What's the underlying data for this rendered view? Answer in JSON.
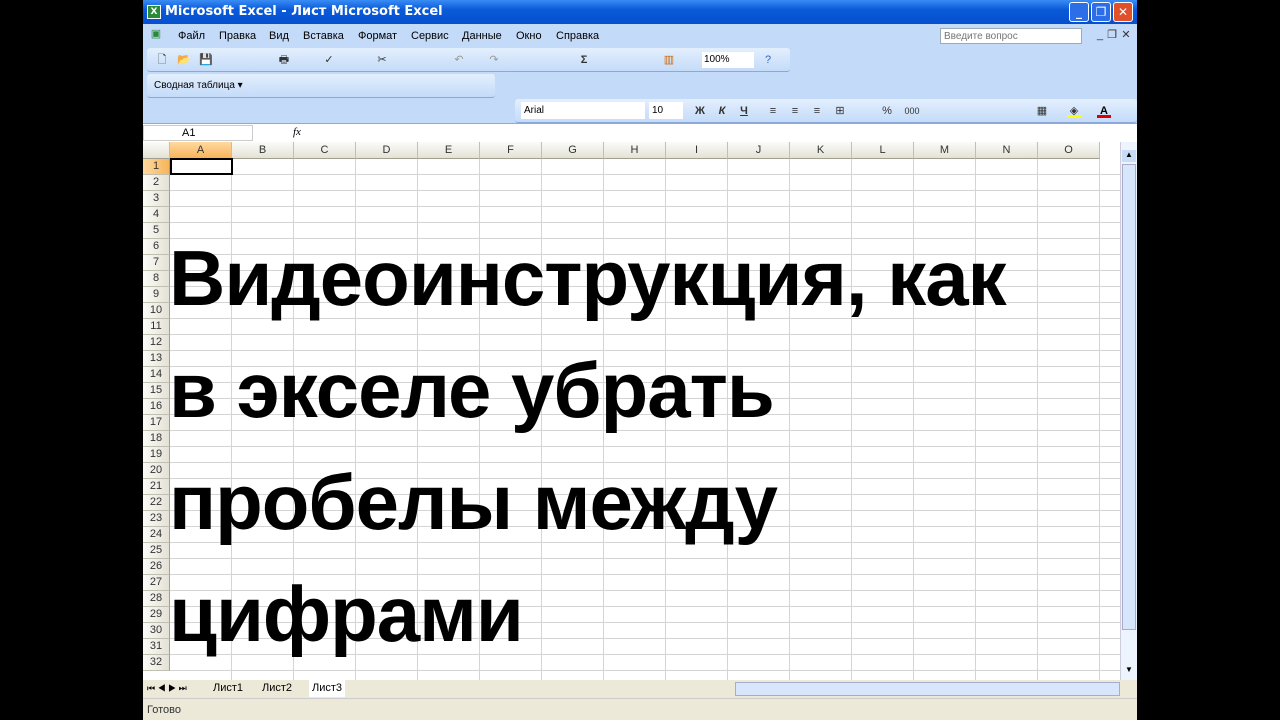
{
  "window": {
    "title": "Microsoft Excel - Лист Microsoft Excel"
  },
  "menu": [
    "Файл",
    "Правка",
    "Вид",
    "Вставка",
    "Формат",
    "Сервис",
    "Данные",
    "Окно",
    "Справка"
  ],
  "help": {
    "placeholder": "Введите вопрос"
  },
  "toolbar": {
    "zoom": "100%"
  },
  "pivot": {
    "label": "Сводная таблица ▾"
  },
  "format": {
    "font": "Arial",
    "size": "10",
    "bold": "Ж",
    "italic": "К",
    "underline": "Ч",
    "percent": "%",
    "thousands": "000"
  },
  "formula": {
    "name_box": "A1",
    "fx": "fx",
    "value": ""
  },
  "columns": [
    "A",
    "B",
    "C",
    "D",
    "E",
    "F",
    "G",
    "H",
    "I",
    "J",
    "K",
    "L",
    "M",
    "N",
    "O"
  ],
  "rows": [
    "1",
    "2",
    "3",
    "4",
    "5",
    "6",
    "7",
    "8",
    "9",
    "10",
    "11",
    "12",
    "13",
    "14",
    "15",
    "16",
    "17",
    "18",
    "19",
    "20",
    "21",
    "22",
    "23",
    "24",
    "25",
    "26",
    "27",
    "28",
    "29",
    "30",
    "31",
    "32"
  ],
  "overlay": [
    "Видеоинструкция, как",
    "в экселе убрать",
    "пробелы между",
    "цифрами"
  ],
  "sheets": [
    "Лист1",
    "Лист2",
    "Лист3"
  ],
  "active_sheet": "Лист3",
  "status": "Готово"
}
